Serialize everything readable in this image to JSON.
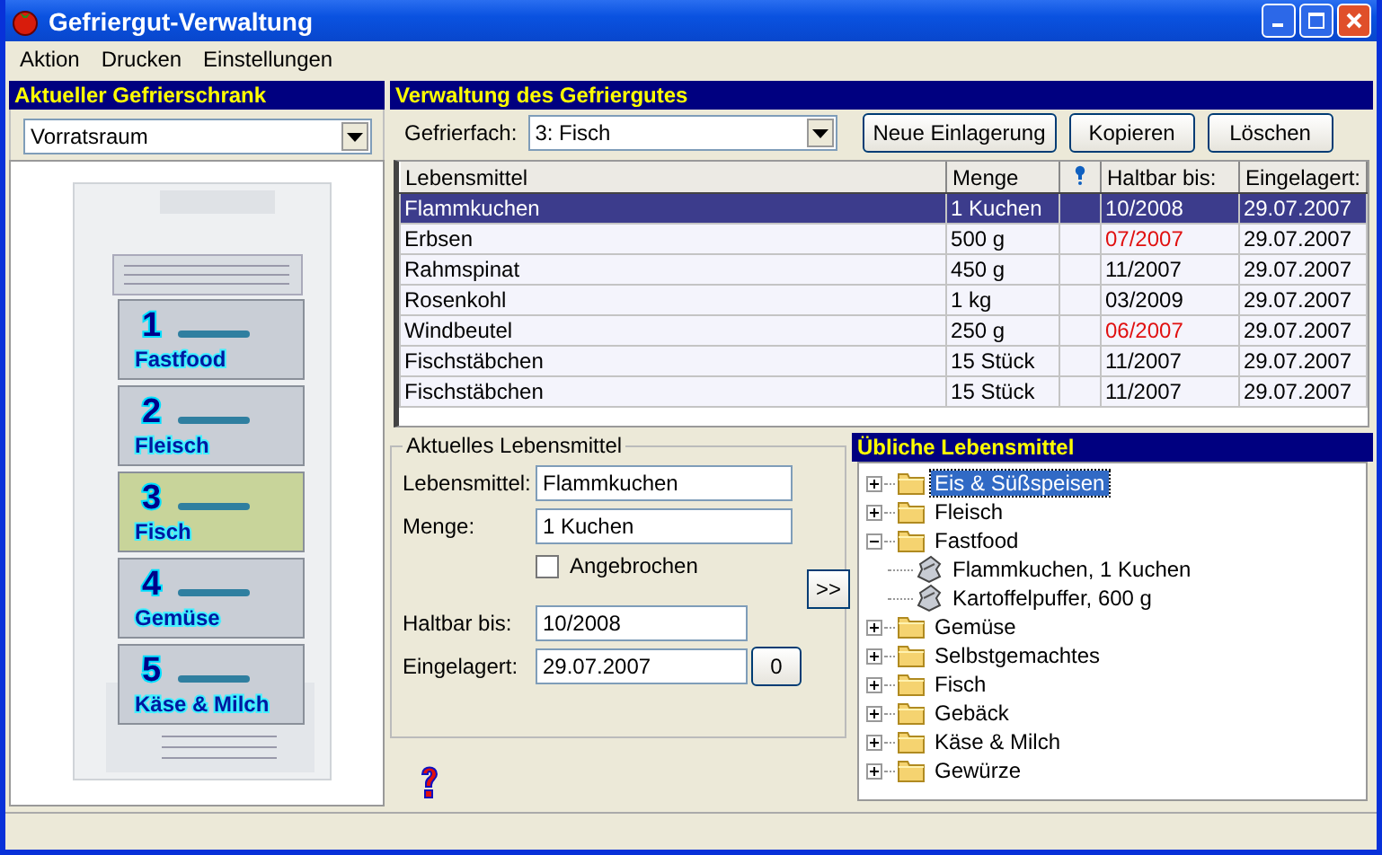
{
  "window": {
    "title": "Gefriergut-Verwaltung"
  },
  "menu": [
    "Aktion",
    "Drucken",
    "Einstellungen"
  ],
  "freezer_panel": {
    "title": "Aktueller Gefrierschrank",
    "location": "Vorratsraum",
    "drawers": [
      {
        "number": "1",
        "name": "Fastfood",
        "selected": false
      },
      {
        "number": "2",
        "name": "Fleisch",
        "selected": false
      },
      {
        "number": "3",
        "name": "Fisch",
        "selected": true
      },
      {
        "number": "4",
        "name": "Gemüse",
        "selected": false
      },
      {
        "number": "5",
        "name": "Käse & Milch",
        "selected": false
      }
    ]
  },
  "management": {
    "title": "Verwaltung des Gefriergutes",
    "compartment_label": "Gefrierfach:",
    "compartment": "3: Fisch",
    "buttons": [
      "Neue Einlagerung",
      "Kopieren",
      "Löschen"
    ],
    "table": {
      "columns": [
        {
          "kind": "text",
          "label": "Lebensmittel"
        },
        {
          "kind": "text",
          "label": "Menge"
        },
        {
          "kind": "icon"
        },
        {
          "kind": "text",
          "label": "Haltbar bis:"
        },
        {
          "kind": "text",
          "label": "Eingelagert:"
        }
      ],
      "rows": [
        {
          "cells": [
            "Flammkuchen",
            "1 Kuchen",
            "",
            "10/2008",
            "29.07.2007"
          ],
          "selected": true,
          "expired": false
        },
        {
          "cells": [
            "Erbsen",
            "500 g",
            "",
            "07/2007",
            "29.07.2007"
          ],
          "selected": false,
          "expired": true
        },
        {
          "cells": [
            "Rahmspinat",
            "450 g",
            "",
            "11/2007",
            "29.07.2007"
          ],
          "selected": false,
          "expired": false
        },
        {
          "cells": [
            "Rosenkohl",
            "1 kg",
            "",
            "03/2009",
            "29.07.2007"
          ],
          "selected": false,
          "expired": false
        },
        {
          "cells": [
            "Windbeutel",
            "250 g",
            "",
            "06/2007",
            "29.07.2007"
          ],
          "selected": false,
          "expired": true
        },
        {
          "cells": [
            "Fischstäbchen",
            "15 Stück",
            "",
            "11/2007",
            "29.07.2007"
          ],
          "selected": false,
          "expired": false
        },
        {
          "cells": [
            "Fischstäbchen",
            "15 Stück",
            "",
            "11/2007",
            "29.07.2007"
          ],
          "selected": false,
          "expired": false
        }
      ]
    }
  },
  "current_item": {
    "title": "Aktuelles Lebensmittel",
    "food_label": "Lebensmittel:",
    "food": "Flammkuchen",
    "amount_label": "Menge:",
    "amount": "1 Kuchen",
    "opened_label": "Angebrochen",
    "opened": false,
    "best_before_label": "Haltbar bis:",
    "best_before": "10/2008",
    "stored_label": "Eingelagert:",
    "stored": "29.07.2007",
    "today_button": "0",
    "transfer_button": ">>"
  },
  "common_foods": {
    "title": "Übliche Lebensmittel",
    "tree": [
      {
        "label": "Eis & Süßspeisen",
        "kind": "folder",
        "expanded": false,
        "selected": true
      },
      {
        "label": "Fleisch",
        "kind": "folder",
        "expanded": false,
        "selected": false
      },
      {
        "label": "Fastfood",
        "kind": "folder",
        "expanded": true,
        "selected": false,
        "children": [
          {
            "label": "Flammkuchen, 1 Kuchen",
            "kind": "item",
            "selected": false
          },
          {
            "label": "Kartoffelpuffer, 600 g",
            "kind": "item",
            "selected": false
          }
        ]
      },
      {
        "label": "Gemüse",
        "kind": "folder",
        "expanded": false,
        "selected": false
      },
      {
        "label": "Selbstgemachtes",
        "kind": "folder",
        "expanded": false,
        "selected": false
      },
      {
        "label": "Fisch",
        "kind": "folder",
        "expanded": false,
        "selected": false
      },
      {
        "label": "Gebäck",
        "kind": "folder",
        "expanded": false,
        "selected": false
      },
      {
        "label": "Käse & Milch",
        "kind": "folder",
        "expanded": false,
        "selected": false
      },
      {
        "label": "Gewürze",
        "kind": "folder",
        "expanded": false,
        "selected": false
      }
    ]
  }
}
